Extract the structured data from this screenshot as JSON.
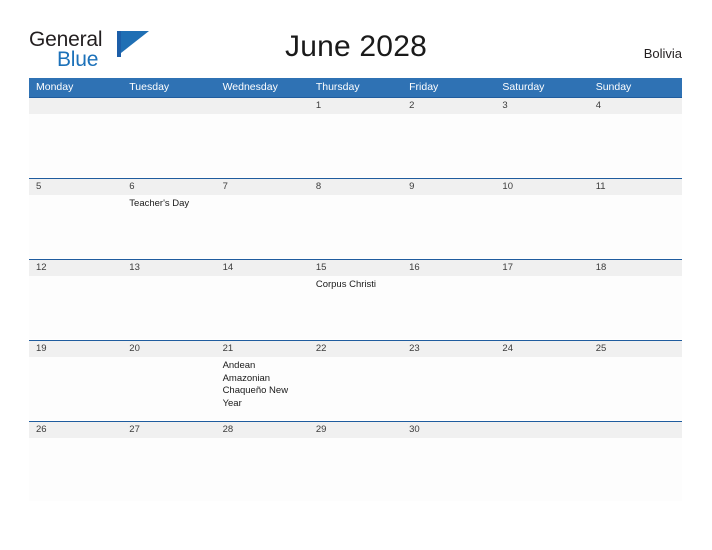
{
  "brand": {
    "word_one": "General",
    "word_two": "Blue",
    "flag_icon": "blue-flag-triangle"
  },
  "header": {
    "title": "June 2028",
    "country": "Bolivia"
  },
  "calendar": {
    "weekdays": [
      "Monday",
      "Tuesday",
      "Wednesday",
      "Thursday",
      "Friday",
      "Saturday",
      "Sunday"
    ],
    "accent_color": "#2f72b4",
    "band_color": "#f0f0f0",
    "rule_color": "#1f5c9e",
    "weeks": [
      {
        "days": [
          {
            "date": "",
            "events": []
          },
          {
            "date": "",
            "events": []
          },
          {
            "date": "",
            "events": []
          },
          {
            "date": "1",
            "events": []
          },
          {
            "date": "2",
            "events": []
          },
          {
            "date": "3",
            "events": []
          },
          {
            "date": "4",
            "events": []
          }
        ]
      },
      {
        "days": [
          {
            "date": "5",
            "events": []
          },
          {
            "date": "6",
            "events": [
              "Teacher's Day"
            ]
          },
          {
            "date": "7",
            "events": []
          },
          {
            "date": "8",
            "events": []
          },
          {
            "date": "9",
            "events": []
          },
          {
            "date": "10",
            "events": []
          },
          {
            "date": "11",
            "events": []
          }
        ]
      },
      {
        "days": [
          {
            "date": "12",
            "events": []
          },
          {
            "date": "13",
            "events": []
          },
          {
            "date": "14",
            "events": []
          },
          {
            "date": "15",
            "events": [
              "Corpus Christi"
            ]
          },
          {
            "date": "16",
            "events": []
          },
          {
            "date": "17",
            "events": []
          },
          {
            "date": "18",
            "events": []
          }
        ]
      },
      {
        "days": [
          {
            "date": "19",
            "events": []
          },
          {
            "date": "20",
            "events": []
          },
          {
            "date": "21",
            "events": [
              "Andean Amazonian Chaqueño New Year"
            ]
          },
          {
            "date": "22",
            "events": []
          },
          {
            "date": "23",
            "events": []
          },
          {
            "date": "24",
            "events": []
          },
          {
            "date": "25",
            "events": []
          }
        ]
      },
      {
        "days": [
          {
            "date": "26",
            "events": []
          },
          {
            "date": "27",
            "events": []
          },
          {
            "date": "28",
            "events": []
          },
          {
            "date": "29",
            "events": []
          },
          {
            "date": "30",
            "events": []
          },
          {
            "date": "",
            "events": []
          },
          {
            "date": "",
            "events": []
          }
        ]
      }
    ]
  }
}
